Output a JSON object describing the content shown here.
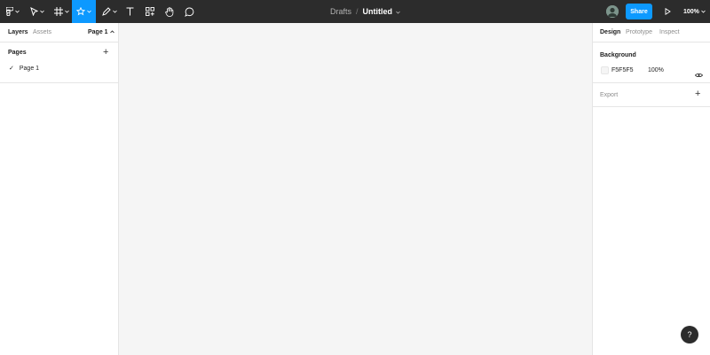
{
  "toolbar": {
    "main_menu_icon": "figma-logo-icon",
    "move_tool_icon": "cursor-icon",
    "frame_tool_icon": "frame-hash-icon",
    "shape_tool_icon": "star-icon",
    "pen_tool_icon": "pen-icon",
    "text_tool_icon": "text-icon",
    "resources_icon": "resources-icon",
    "hand_tool_icon": "hand-icon",
    "comment_tool_icon": "comment-icon",
    "active_color": "#0d99ff"
  },
  "breadcrumb": {
    "location": "Drafts",
    "separator": "/",
    "file_title": "Untitled"
  },
  "header_right": {
    "share_label": "Share",
    "zoom_label": "100%",
    "share_color": "#0d99ff"
  },
  "left_panel": {
    "tabs": [
      "Layers",
      "Assets"
    ],
    "page_selector": "Page 1",
    "pages_title": "Pages",
    "pages": [
      "Page 1"
    ]
  },
  "right_panel": {
    "tabs": [
      "Design",
      "Prototype",
      "Inspect"
    ],
    "background_title": "Background",
    "background_hex": "F5F5F5",
    "background_opacity": "100%",
    "export_title": "Export"
  },
  "help": {
    "label": "?"
  }
}
